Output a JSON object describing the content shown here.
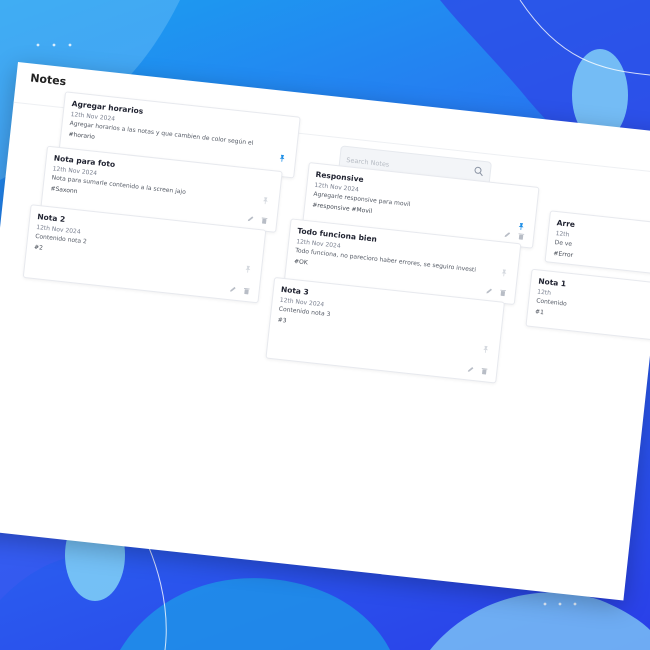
{
  "header": {
    "title": "Notes"
  },
  "search": {
    "placeholder": "Search Notes"
  },
  "notes": [
    {
      "title": "Agregar horarios",
      "date": "12th Nov 2024",
      "content": "Agregar horarios a las notas y que cambien de color según el",
      "tag": "#horario",
      "pinned": true
    },
    {
      "title": "Responsive",
      "date": "12th Nov 2024",
      "content": "Agregarle responsive para movil",
      "tag": "#responsive #Movil",
      "pinned": true
    },
    {
      "title": "Arre",
      "date": "12th",
      "content": "De ve",
      "tag": "#Error",
      "pinned": false
    },
    {
      "title": "Nota para foto",
      "date": "12th Nov 2024",
      "content": "Nota para sumarle contenido a la screen jajo",
      "tag": "#Saxonn",
      "pinned": false
    },
    {
      "title": "Todo funciona bien",
      "date": "12th Nov 2024",
      "content": "Todo funciona, no parecioro haber errores, se seguiro investi",
      "tag": "#OK",
      "pinned": false
    },
    {
      "title": "Nota 2",
      "date": "12th Nov 2024",
      "content": "Contenido nota 2",
      "tag": "#2",
      "pinned": false
    },
    {
      "title": "Nota 3",
      "date": "12th Nov 2024",
      "content": "Contenido nota 3",
      "tag": "#3",
      "pinned": false
    },
    {
      "title": "Nota 1",
      "date": "12th",
      "content": "Contenido",
      "tag": "#1",
      "pinned": false
    }
  ],
  "colors": {
    "accent": "#1f8fe6",
    "background": "#2a5ef0"
  }
}
